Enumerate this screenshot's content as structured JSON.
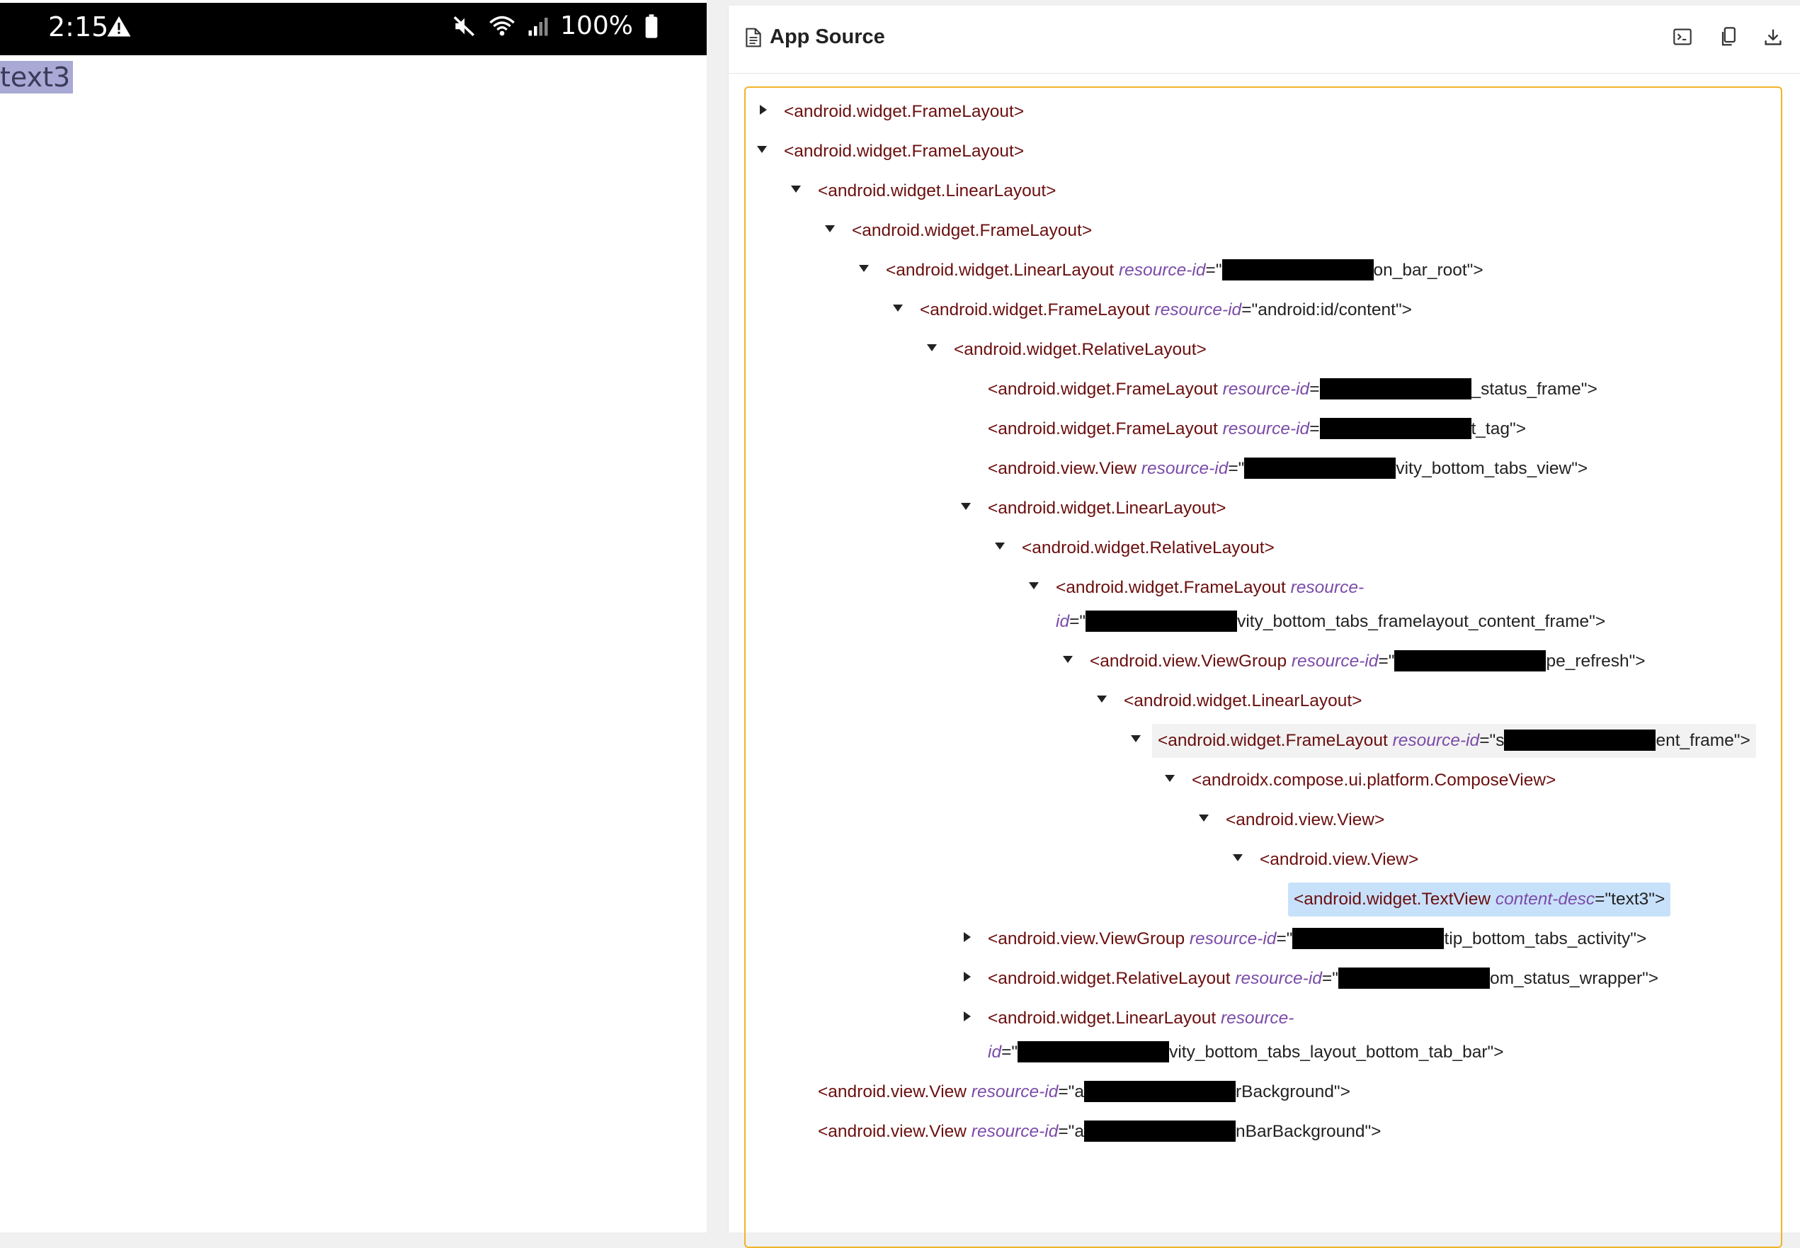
{
  "device": {
    "status_time": "2:15",
    "battery": "100%",
    "screen_text": "text3"
  },
  "panel": {
    "title": "App Source",
    "tools": [
      "terminal-icon",
      "copy-icon",
      "download-icon"
    ]
  },
  "tree": {
    "r1": "<android.widget.FrameLayout>",
    "r2": "<android.widget.FrameLayout>",
    "r3": "<android.widget.LinearLayout>",
    "r4": "<android.widget.FrameLayout>",
    "r5_tag": "<android.widget.LinearLayout ",
    "r5_attr": "resource-id",
    "r5_pre": "=\"",
    "r5_post": "on_bar_root\">",
    "r6_tag": "<android.widget.FrameLayout ",
    "r6_attr": "resource-id",
    "r6_val": "=\"android:id/content\">",
    "r7": "<android.widget.RelativeLayout>",
    "r8_tag": "<android.widget.FrameLayout ",
    "r8_attr": "resource-id",
    "r8_pre": "=",
    "r8_post": "_status_frame\">",
    "r9_tag": "<android.widget.FrameLayout ",
    "r9_attr": "resource-id",
    "r9_pre": "=",
    "r9_post": "t_tag\">",
    "r10_tag": "<android.view.View ",
    "r10_attr": "resource-id",
    "r10_pre": "=\"",
    "r10_post": "vity_bottom_tabs_view\">",
    "r11": "<android.widget.LinearLayout>",
    "r12": "<android.widget.RelativeLayout>",
    "r13_tag": "<android.widget.FrameLayout ",
    "r13_attr": "resource-",
    "r13_attr2": "id",
    "r13_pre": "=\"",
    "r13_post": "vity_bottom_tabs_framelayout_content_frame\">",
    "r14_tag": "<android.view.ViewGroup ",
    "r14_attr": "resource-id",
    "r14_pre": "=\"",
    "r14_post": "pe_refresh\">",
    "r15": "<android.widget.LinearLayout>",
    "r16_tag": "<android.widget.FrameLayout ",
    "r16_attr": "resource-id",
    "r16_pre": "=\"s",
    "r16_post": "ent_frame\">",
    "r17": "<androidx.compose.ui.platform.ComposeView>",
    "r18": "<android.view.View>",
    "r19": "<android.view.View>",
    "r20_tag": "<android.widget.TextView ",
    "r20_attr": "content-desc",
    "r20_val": "=\"text3\">",
    "r21_tag": "<android.view.ViewGroup ",
    "r21_attr": "resource-id",
    "r21_pre": "=\"",
    "r21_post": "tip_bottom_tabs_activity\">",
    "r22_tag": "<android.widget.RelativeLayout ",
    "r22_attr": "resource-id",
    "r22_pre": "=\"",
    "r22_post": "om_status_wrapper\">",
    "r23_tag": "<android.widget.LinearLayout ",
    "r23_attr": "resource-",
    "r23_attr2": "id",
    "r23_pre": "=\"",
    "r23_post": "vity_bottom_tabs_layout_bottom_tab_bar\">",
    "r24_tag": "<android.view.View ",
    "r24_attr": "resource-id",
    "r24_pre": "=\"a",
    "r24_post": "rBackground\">",
    "r25_tag": "<android.view.View ",
    "r25_attr": "resource-id",
    "r25_pre": "=\"a",
    "r25_post": "nBarBackground\">"
  }
}
